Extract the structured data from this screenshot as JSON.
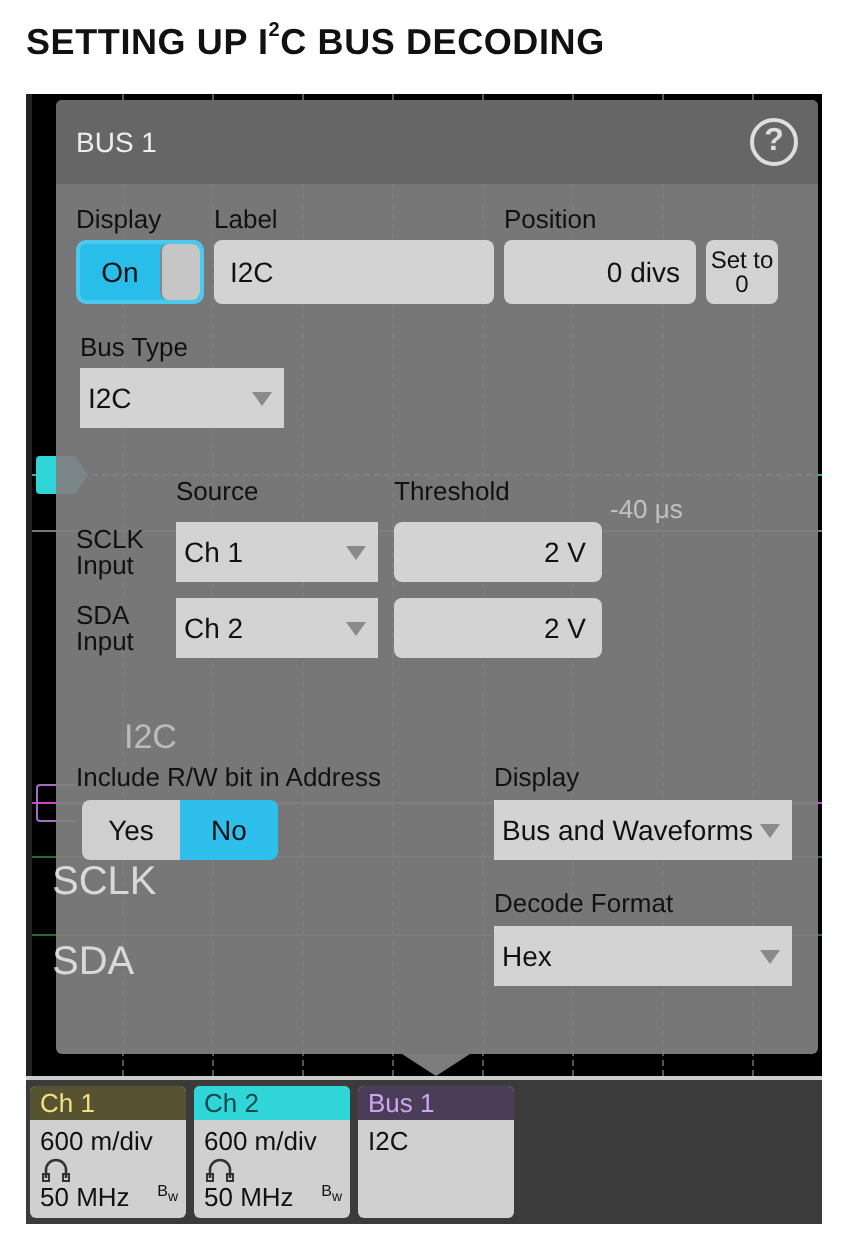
{
  "heading": "SETTING UP I$^{2}$C BUS DECODING",
  "scope": {
    "time_label": "-40 μs",
    "traces": [
      {
        "kind": "bus",
        "text": "I2C"
      },
      {
        "kind": "signal",
        "text": "SCLK"
      },
      {
        "kind": "signal",
        "text": "SDA"
      }
    ]
  },
  "dialog": {
    "title": "BUS 1",
    "help": "?",
    "display": {
      "label": "Display",
      "text": "On",
      "on": true
    },
    "label_field": {
      "label": "Label",
      "value": "I2C"
    },
    "position": {
      "label": "Position",
      "value": "0 divs",
      "reset": "Set to 0"
    },
    "bus_type": {
      "label": "Bus Type",
      "value": "I2C"
    },
    "inputs": {
      "columns": [
        "Source",
        "Threshold"
      ],
      "rows": [
        {
          "label": "SCLK Input",
          "source": "Ch 1",
          "threshold": "2 V"
        },
        {
          "label": "SDA Input",
          "source": "Ch 2",
          "threshold": "2 V"
        }
      ]
    },
    "rw_bit": {
      "label": "Include R/W bit in Address",
      "options": [
        {
          "label": "Yes",
          "selected": false
        },
        {
          "label": "No",
          "selected": true
        }
      ]
    },
    "display_mode": {
      "label": "Display",
      "value": "Bus and Waveforms"
    },
    "decode_format": {
      "label": "Decode Format",
      "value": "Hex"
    }
  },
  "badges": [
    {
      "kind": "channel",
      "title": "Ch 1",
      "color": "#575230",
      "scale": "600 m/div",
      "bandwidth": "50 MHz",
      "bw_mark": "B$_{w}$"
    },
    {
      "kind": "channel",
      "title": "Ch 2",
      "color": "#30d5d8",
      "scale": "600 m/div",
      "bandwidth": "50 MHz",
      "bw_mark": "B$_{w}$"
    },
    {
      "kind": "bus",
      "title": "Bus 1",
      "color": "#4b3d58",
      "body": "I2C"
    }
  ]
}
